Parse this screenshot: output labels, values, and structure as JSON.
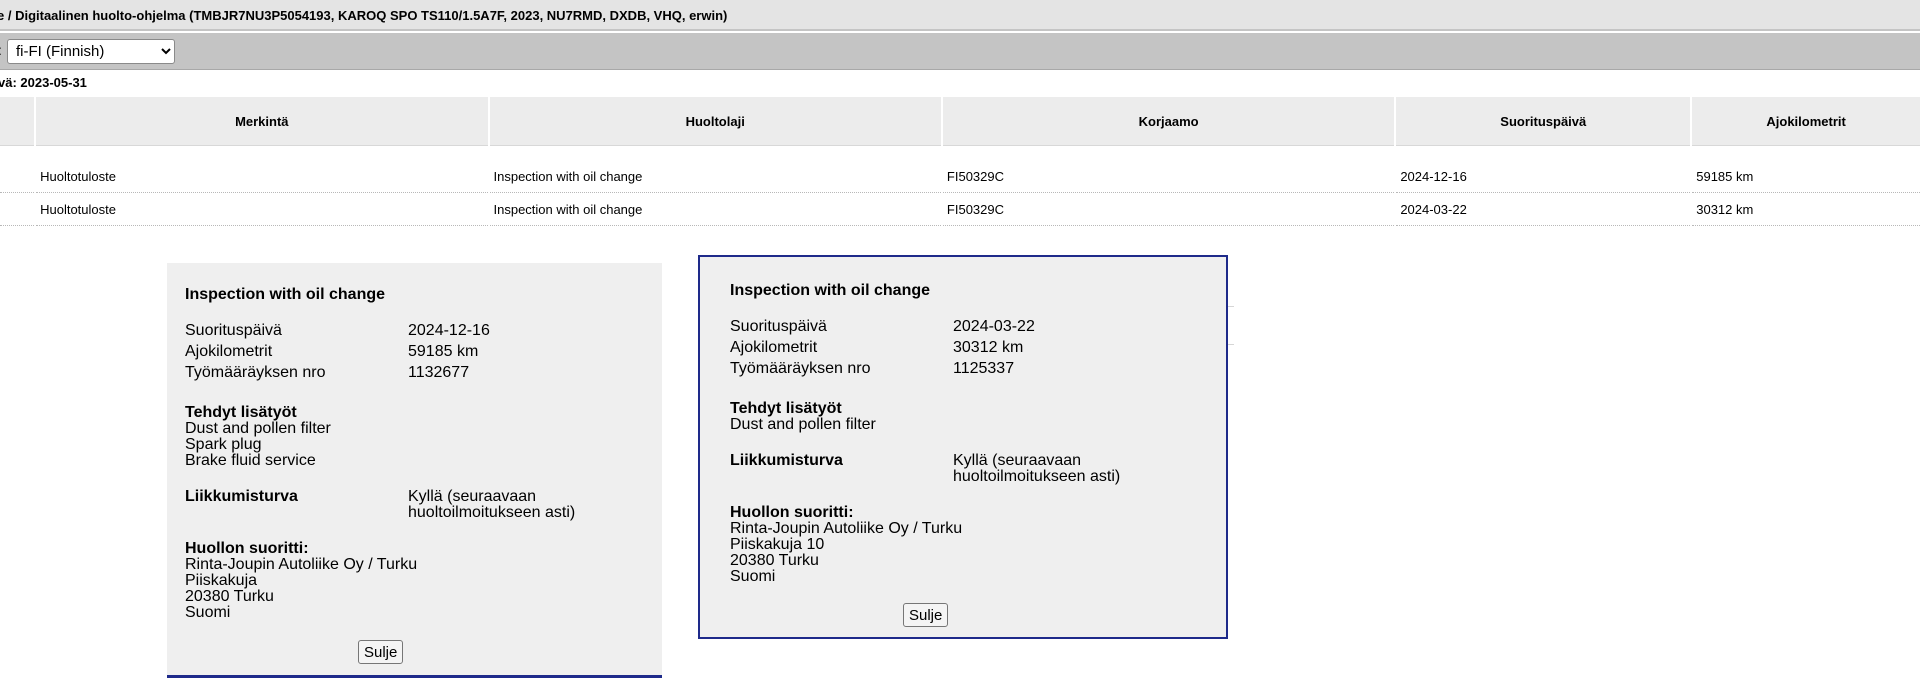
{
  "header": {
    "title": "e / Digitaalinen huolto-ohjelma (TMBJR7NU3P5054193, KAROQ SPO TS110/1.5A7F, 2023, NU7RMD, DXDB, VHQ, erwin)"
  },
  "language": {
    "label": ":",
    "selected": "fi-FI (Finnish)"
  },
  "date_line": "vä: 2023-05-31",
  "table": {
    "columns": [
      "Merkintä",
      "Huoltolaji",
      "Korjaamo",
      "Suorituspäivä",
      "Ajokilometrit"
    ],
    "rows": [
      [
        "Huoltotuloste",
        "Inspection with oil change",
        "FI50329C",
        "2024-12-16",
        "59185 km"
      ],
      [
        "Huoltotuloste",
        "Inspection with oil change",
        "FI50329C",
        "2024-03-22",
        "30312 km"
      ]
    ]
  },
  "popup1": {
    "title": "Inspection with oil change",
    "fields": [
      {
        "label": "Suorituspäivä",
        "value": "2024-12-16"
      },
      {
        "label": "Ajokilometrit",
        "value": "59185 km"
      },
      {
        "label": "Työmääräyksen nro",
        "value": "1132677"
      }
    ],
    "extra_title": "Tehdyt lisätyöt",
    "extra_items": [
      "Dust and pollen filter",
      "Spark plug",
      "Brake fluid service"
    ],
    "mobility_label": "Liikkumisturva",
    "mobility_value": [
      "Kyllä (seuraavaan",
      "huoltoilmoitukseen asti)"
    ],
    "performer_title": "Huollon suoritti:",
    "performer_lines": [
      "Rinta-Joupin Autoliike Oy / Turku",
      "Piiskakuja",
      "20380 Turku",
      "Suomi"
    ],
    "close_label": "Sulje"
  },
  "popup2": {
    "title": "Inspection with oil change",
    "fields": [
      {
        "label": "Suorituspäivä",
        "value": "2024-03-22"
      },
      {
        "label": "Ajokilometrit",
        "value": "30312 km"
      },
      {
        "label": "Työmääräyksen nro",
        "value": "1125337"
      }
    ],
    "extra_title": "Tehdyt lisätyöt",
    "extra_items": [
      "Dust and pollen filter"
    ],
    "mobility_label": "Liikkumisturva",
    "mobility_value": [
      "Kyllä (seuraavaan",
      "huoltoilmoitukseen asti)"
    ],
    "performer_title": "Huollon suoritti:",
    "performer_lines": [
      "Rinta-Joupin Autoliike Oy / Turku",
      "Piiskakuja 10",
      "20380 Turku",
      "Suomi"
    ],
    "close_label": "Sulje"
  }
}
